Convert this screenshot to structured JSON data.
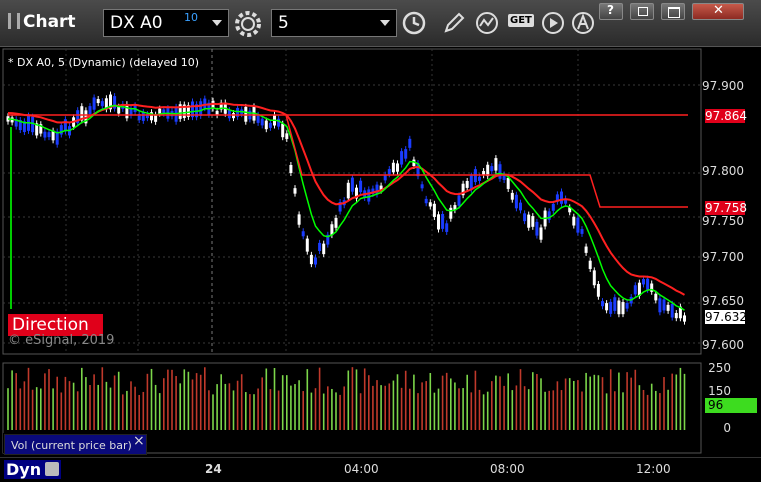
{
  "window": {
    "title": "Chart",
    "symbol": "DX A0",
    "symbol_badge": "10",
    "interval": "5",
    "get_label": "GET"
  },
  "chart": {
    "info": "* DX A0, 5 (Dynamic) (delayed 10)",
    "direction_label": "Direction",
    "copyright": "© eSignal, 2019",
    "price_axis": [
      "97.900",
      "97.800",
      "97.750",
      "97.700",
      "97.650",
      "97.600"
    ],
    "price_tags": {
      "upper": "97.864",
      "mid": "97.758",
      "last": "97.632"
    }
  },
  "volume": {
    "label": "Vol (current price bar)",
    "close": "×",
    "axis": [
      "250",
      "150",
      "0"
    ],
    "current": "96"
  },
  "time_axis": [
    "24",
    "04:00",
    "08:00",
    "12:00"
  ],
  "bottom": {
    "dyn_label": "Dyn"
  },
  "colors": {
    "up_bar": "#ffffff",
    "down_bar": "#1a3cff",
    "ema_fast": "#00ff00",
    "ema_slow": "#ff2020",
    "vol_up": "#7cd64a",
    "vol_down": "#c0392b",
    "accent": "#e0001a"
  },
  "icons": [
    "settings-icon",
    "clock-icon",
    "pencil-icon",
    "indicator-icon",
    "get-icon",
    "play-icon",
    "text-tool-icon"
  ]
}
